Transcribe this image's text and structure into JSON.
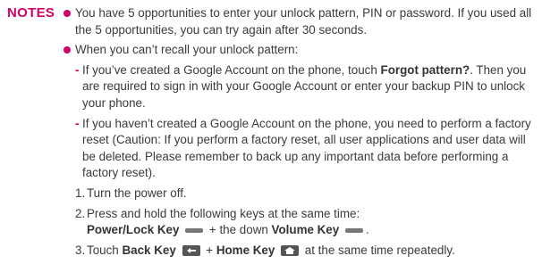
{
  "label": "NOTES",
  "bullet1": "You have 5 opportunities to enter your unlock pattern, PIN or password. If you used all the 5 opportunities, you can try again after 30 seconds.",
  "bullet2": "When you can’t recall your unlock pattern:",
  "sub1": {
    "before": "If you’ve created a Google Account on the phone, touch ",
    "bold": "Forgot pattern?",
    "after": ". Then you are required to sign in with your Google Account or enter your backup PIN to unlock your phone."
  },
  "sub2": "If you haven’t created a Google Account on the phone, you need to perform a factory reset (Caution: If you perform a factory reset, all user applications and user data will be deleted. Please remember to back up any important data before performing a factory reset).",
  "steps": {
    "s1_num": "1.",
    "s1": "Turn the power off.",
    "s2_num": "2.",
    "s2": "Press and hold the following keys at the same time:",
    "s2_key1": "Power/Lock Key",
    "s2_plus": "+ the down",
    "s2_key2": "Volume Key",
    "s2_end": ".",
    "s3_num": "3.",
    "s3_pre": "Touch",
    "s3_key1": "Back Key",
    "s3_plus": "+",
    "s3_key2": "Home Key",
    "s3_end": "at the same time repeatedly."
  },
  "colors": {
    "accent": "#d4006a",
    "text": "#3a3a3a"
  },
  "icons": [
    "power-key-icon",
    "volume-key-icon",
    "back-key-icon",
    "home-key-icon"
  ]
}
